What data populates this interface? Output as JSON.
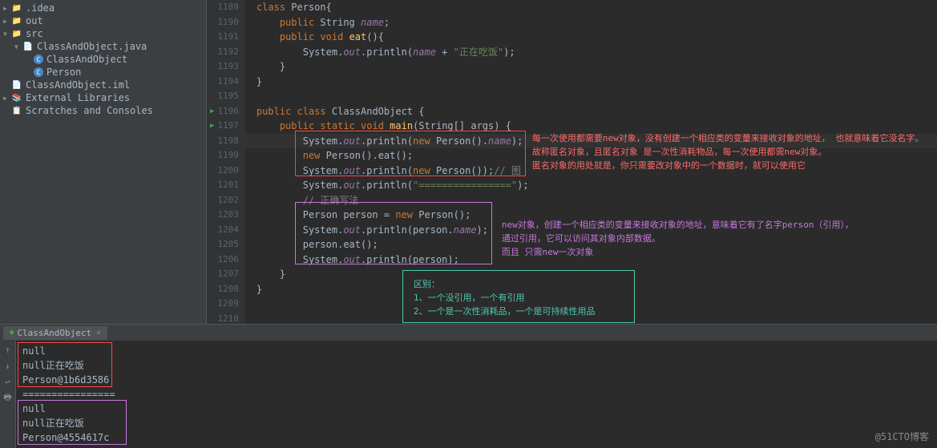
{
  "tree": {
    "idea": ".idea",
    "out": "out",
    "src": "src",
    "classAndObjectJava": "ClassAndObject.java",
    "classAndObject": "ClassAndObject",
    "person": "Person",
    "iml": "ClassAndObject.iml",
    "externalLibs": "External Libraries",
    "scratches": "Scratches and Consoles"
  },
  "lines": {
    "1189": "1189",
    "1190": "1190",
    "1191": "1191",
    "1192": "1192",
    "1193": "1193",
    "1194": "1194",
    "1195": "1195",
    "1196": "1196",
    "1197": "1197",
    "1198": "1198",
    "1199": "1199",
    "1200": "1200",
    "1201": "1201",
    "1202": "1202",
    "1203": "1203",
    "1204": "1204",
    "1205": "1205",
    "1206": "1206",
    "1207": "1207",
    "1208": "1208",
    "1209": "1209",
    "1210": "1210"
  },
  "code": {
    "kw_class": "class",
    "kw_public": "public",
    "kw_void": "void",
    "kw_new": "new",
    "kw_static": "static",
    "Person": "Person",
    "ClassAndObject": "ClassAndObject",
    "String": "String",
    "System": "System",
    "out": "out",
    "println": "println",
    "name": "name",
    "eat": "eat",
    "main": "main",
    "args": "args",
    "person": "person",
    "str_eating": "\"正在吃饭\"",
    "str_equals": "\"================\"",
    "comment_tu": "// 图",
    "comment_correct": "// 正确写法"
  },
  "annotations": {
    "red1": "每一次使用都需要new对象，没有创建一个相应类的变量来接收对象的地址， 也就意味着它没名字。",
    "red2": "故称匿名对象，且匿名对象 是一次性消耗物品，每一次使用都需new对象。",
    "red3": "匿名对象的用处就是，你只需要改对象中的一个数据时，就可以使用它",
    "purple1": "new对象，创建一个相应类的变量来接收对象的地址，意味着它有了名字person（引用），",
    "purple2": "通过引用，它可以访问其对象内部数据。",
    "purple3": "而且 只需new一次对象",
    "teal1": "区别：",
    "teal2": "1、一个没引用，一个有引用",
    "teal3": "2、一个是一次性消耗品，一个是可持续性用品"
  },
  "panel": {
    "tabName": "ClassAndObject"
  },
  "console": {
    "l1": "null",
    "l2": "null正在吃饭",
    "l3": "Person@1b6d3586",
    "l4": "================",
    "l5": "null",
    "l6": "null正在吃饭",
    "l7": "Person@4554617c"
  },
  "watermark": "@51CTO博客"
}
